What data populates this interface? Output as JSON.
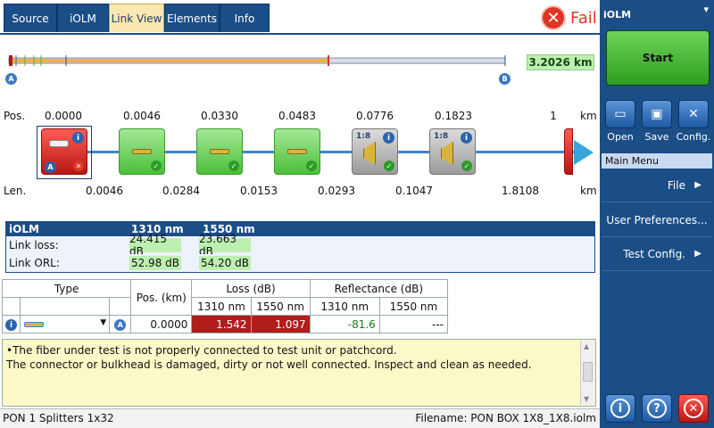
{
  "tabs": [
    {
      "label": "Source"
    },
    {
      "label": "iOLM"
    },
    {
      "label": "Link View",
      "active": true
    },
    {
      "label": "Elements"
    },
    {
      "label": "Info"
    }
  ],
  "result": {
    "label": "Fail",
    "color": "#e03526"
  },
  "overview": {
    "distance": "3.2026 km",
    "start_marker": "A",
    "end_marker": "B"
  },
  "link": {
    "pos_label": "Pos.",
    "len_label": "Len.",
    "unit": "km",
    "positions": [
      "0.0000",
      "0.0046",
      "0.0330",
      "0.0483",
      "0.0776",
      "0.1823",
      "1"
    ],
    "lengths": [
      "0.0046",
      "0.0284",
      "0.0153",
      "0.0293",
      "0.1047",
      "1.8108"
    ],
    "elements": [
      {
        "type": "connector-fail",
        "badge": "A"
      },
      {
        "type": "connector-pass"
      },
      {
        "type": "connector-pass"
      },
      {
        "type": "connector-pass"
      },
      {
        "type": "splitter",
        "ratio": "1:8"
      },
      {
        "type": "splitter",
        "ratio": "1:8"
      }
    ]
  },
  "results": {
    "headers": [
      "iOLM",
      "1310 nm",
      "1550 nm"
    ],
    "rows": [
      {
        "label": "Link loss:",
        "v1310": "24.415 dB",
        "v1550": "23.663 dB"
      },
      {
        "label": "Link ORL:",
        "v1310": "52.98 dB",
        "v1550": "54.20 dB"
      }
    ]
  },
  "event_table": {
    "headers": {
      "type": "Type",
      "pos": "Pos. (km)",
      "loss": "Loss (dB)",
      "refl": "Reflectance (dB)"
    },
    "subheaders": [
      "1310 nm",
      "1550 nm",
      "1310 nm",
      "1550 nm"
    ],
    "row": {
      "marker": "A",
      "pos": "0.0000",
      "loss1310": "1.542",
      "loss1550": "1.097",
      "refl1310": "-81.6",
      "refl1550": "---"
    }
  },
  "message": {
    "line1": "•The fiber under test is not properly connected to test unit or patchcord.",
    "line2": "The connector or bulkhead is damaged, dirty or not well connected. Inspect and clean as needed."
  },
  "status": {
    "left": "PON 1 Splitters 1x32",
    "right": "Filename: PON BOX 1X8_1X8.iolm"
  },
  "side": {
    "app_title": "iOLM",
    "start_label": "Start",
    "tools": [
      {
        "label": "Open"
      },
      {
        "label": "Save"
      },
      {
        "label": "Config."
      }
    ],
    "main_menu_title": "Main Menu",
    "menu": [
      {
        "label": "File"
      },
      {
        "label": "User Preferences..."
      },
      {
        "label": "Test Config."
      }
    ]
  }
}
